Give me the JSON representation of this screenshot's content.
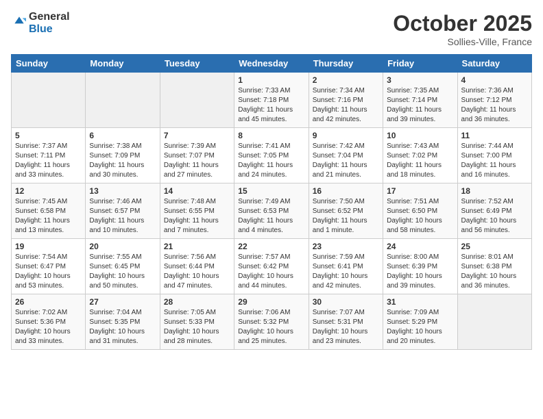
{
  "header": {
    "logo_general": "General",
    "logo_blue": "Blue",
    "month": "October 2025",
    "location": "Sollies-Ville, France"
  },
  "days_of_week": [
    "Sunday",
    "Monday",
    "Tuesday",
    "Wednesday",
    "Thursday",
    "Friday",
    "Saturday"
  ],
  "weeks": [
    [
      {
        "day": "",
        "info": ""
      },
      {
        "day": "",
        "info": ""
      },
      {
        "day": "",
        "info": ""
      },
      {
        "day": "1",
        "info": "Sunrise: 7:33 AM\nSunset: 7:18 PM\nDaylight: 11 hours and 45 minutes."
      },
      {
        "day": "2",
        "info": "Sunrise: 7:34 AM\nSunset: 7:16 PM\nDaylight: 11 hours and 42 minutes."
      },
      {
        "day": "3",
        "info": "Sunrise: 7:35 AM\nSunset: 7:14 PM\nDaylight: 11 hours and 39 minutes."
      },
      {
        "day": "4",
        "info": "Sunrise: 7:36 AM\nSunset: 7:12 PM\nDaylight: 11 hours and 36 minutes."
      }
    ],
    [
      {
        "day": "5",
        "info": "Sunrise: 7:37 AM\nSunset: 7:11 PM\nDaylight: 11 hours and 33 minutes."
      },
      {
        "day": "6",
        "info": "Sunrise: 7:38 AM\nSunset: 7:09 PM\nDaylight: 11 hours and 30 minutes."
      },
      {
        "day": "7",
        "info": "Sunrise: 7:39 AM\nSunset: 7:07 PM\nDaylight: 11 hours and 27 minutes."
      },
      {
        "day": "8",
        "info": "Sunrise: 7:41 AM\nSunset: 7:05 PM\nDaylight: 11 hours and 24 minutes."
      },
      {
        "day": "9",
        "info": "Sunrise: 7:42 AM\nSunset: 7:04 PM\nDaylight: 11 hours and 21 minutes."
      },
      {
        "day": "10",
        "info": "Sunrise: 7:43 AM\nSunset: 7:02 PM\nDaylight: 11 hours and 18 minutes."
      },
      {
        "day": "11",
        "info": "Sunrise: 7:44 AM\nSunset: 7:00 PM\nDaylight: 11 hours and 16 minutes."
      }
    ],
    [
      {
        "day": "12",
        "info": "Sunrise: 7:45 AM\nSunset: 6:58 PM\nDaylight: 11 hours and 13 minutes."
      },
      {
        "day": "13",
        "info": "Sunrise: 7:46 AM\nSunset: 6:57 PM\nDaylight: 11 hours and 10 minutes."
      },
      {
        "day": "14",
        "info": "Sunrise: 7:48 AM\nSunset: 6:55 PM\nDaylight: 11 hours and 7 minutes."
      },
      {
        "day": "15",
        "info": "Sunrise: 7:49 AM\nSunset: 6:53 PM\nDaylight: 11 hours and 4 minutes."
      },
      {
        "day": "16",
        "info": "Sunrise: 7:50 AM\nSunset: 6:52 PM\nDaylight: 11 hours and 1 minute."
      },
      {
        "day": "17",
        "info": "Sunrise: 7:51 AM\nSunset: 6:50 PM\nDaylight: 10 hours and 58 minutes."
      },
      {
        "day": "18",
        "info": "Sunrise: 7:52 AM\nSunset: 6:49 PM\nDaylight: 10 hours and 56 minutes."
      }
    ],
    [
      {
        "day": "19",
        "info": "Sunrise: 7:54 AM\nSunset: 6:47 PM\nDaylight: 10 hours and 53 minutes."
      },
      {
        "day": "20",
        "info": "Sunrise: 7:55 AM\nSunset: 6:45 PM\nDaylight: 10 hours and 50 minutes."
      },
      {
        "day": "21",
        "info": "Sunrise: 7:56 AM\nSunset: 6:44 PM\nDaylight: 10 hours and 47 minutes."
      },
      {
        "day": "22",
        "info": "Sunrise: 7:57 AM\nSunset: 6:42 PM\nDaylight: 10 hours and 44 minutes."
      },
      {
        "day": "23",
        "info": "Sunrise: 7:59 AM\nSunset: 6:41 PM\nDaylight: 10 hours and 42 minutes."
      },
      {
        "day": "24",
        "info": "Sunrise: 8:00 AM\nSunset: 6:39 PM\nDaylight: 10 hours and 39 minutes."
      },
      {
        "day": "25",
        "info": "Sunrise: 8:01 AM\nSunset: 6:38 PM\nDaylight: 10 hours and 36 minutes."
      }
    ],
    [
      {
        "day": "26",
        "info": "Sunrise: 7:02 AM\nSunset: 5:36 PM\nDaylight: 10 hours and 33 minutes."
      },
      {
        "day": "27",
        "info": "Sunrise: 7:04 AM\nSunset: 5:35 PM\nDaylight: 10 hours and 31 minutes."
      },
      {
        "day": "28",
        "info": "Sunrise: 7:05 AM\nSunset: 5:33 PM\nDaylight: 10 hours and 28 minutes."
      },
      {
        "day": "29",
        "info": "Sunrise: 7:06 AM\nSunset: 5:32 PM\nDaylight: 10 hours and 25 minutes."
      },
      {
        "day": "30",
        "info": "Sunrise: 7:07 AM\nSunset: 5:31 PM\nDaylight: 10 hours and 23 minutes."
      },
      {
        "day": "31",
        "info": "Sunrise: 7:09 AM\nSunset: 5:29 PM\nDaylight: 10 hours and 20 minutes."
      },
      {
        "day": "",
        "info": ""
      }
    ]
  ]
}
